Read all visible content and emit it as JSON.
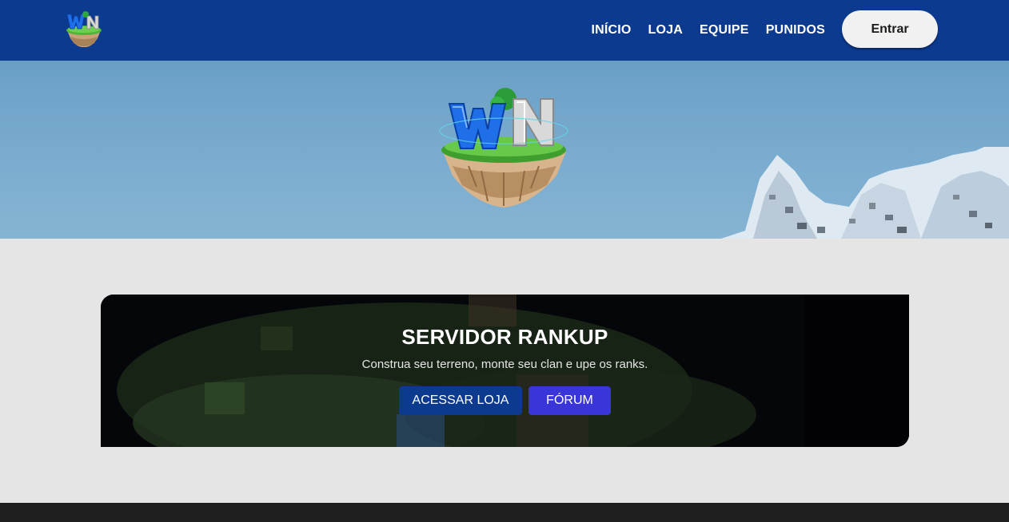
{
  "nav": {
    "logo_icon": "win-island-logo-icon",
    "links": [
      {
        "label": "INÍCIO"
      },
      {
        "label": "LOJA"
      },
      {
        "label": "EQUIPE"
      },
      {
        "label": "PUNIDOS"
      }
    ],
    "login_label": "Entrar"
  },
  "hero": {
    "logo_icon": "win-floating-island-logo-icon",
    "logo_text": "WN"
  },
  "server": {
    "title": "SERVIDOR RANKUP",
    "description": "Construa seu terreno, monte seu clan e upe os ranks.",
    "shop_button": "ACESSAR LOJA",
    "forum_button": "FÓRUM"
  },
  "colors": {
    "nav_bg": "#0b3a8f",
    "shop_button": "#0b3a8f",
    "forum_button": "#3a35d8",
    "page_bg": "#e5e5e5",
    "footer_bg": "#1e1e1e"
  }
}
